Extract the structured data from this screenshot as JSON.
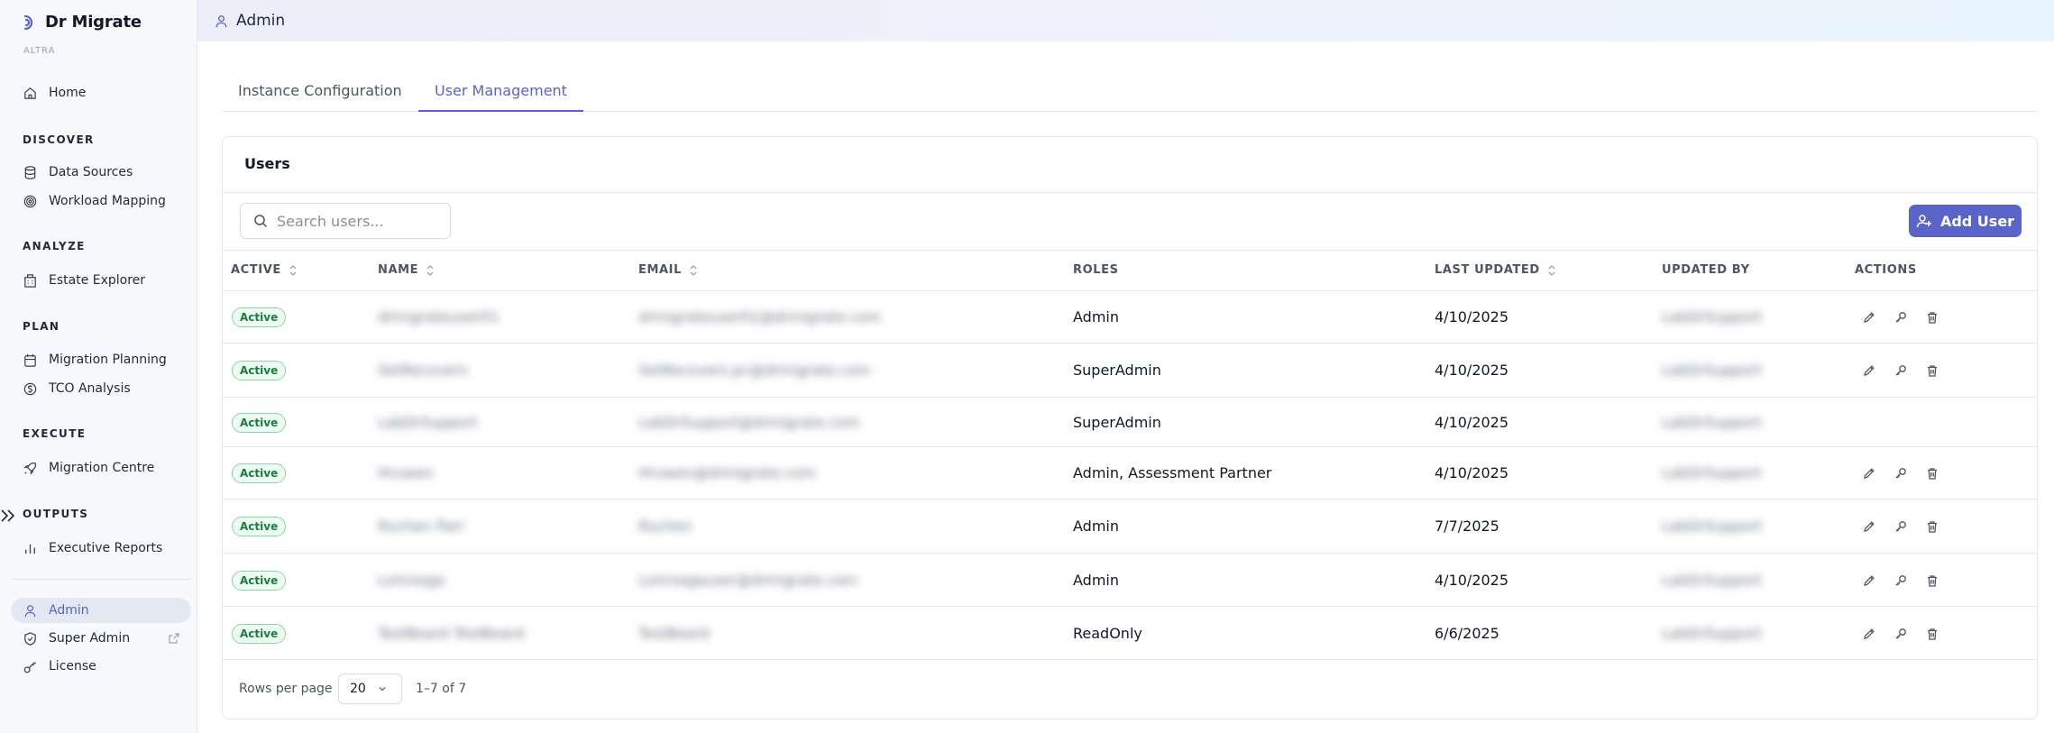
{
  "sidebar": {
    "brand_title": "Dr Migrate",
    "brand_sub": "ALTRA",
    "home": "Home",
    "sections": {
      "discover": "DISCOVER",
      "analyze": "ANALYZE",
      "plan": "PLAN",
      "execute": "EXECUTE",
      "outputs": "OUTPUTS"
    },
    "items": {
      "data_sources": "Data Sources",
      "workload_mapping": "Workload Mapping",
      "estate_explorer": "Estate Explorer",
      "migration_planning": "Migration Planning",
      "tco_analysis": "TCO Analysis",
      "migration_centre": "Migration Centre",
      "executive_reports": "Executive Reports",
      "admin": "Admin",
      "super_admin": "Super Admin",
      "license": "License"
    }
  },
  "header": {
    "title": "Admin"
  },
  "tabs": [
    {
      "label": "Instance Configuration",
      "active": false
    },
    {
      "label": "User Management",
      "active": true
    }
  ],
  "card": {
    "title": "Users",
    "search_placeholder": "Search users...",
    "add_user_label": "Add User"
  },
  "table": {
    "headers": {
      "active": "ACTIVE",
      "name": "NAME",
      "email": "EMAIL",
      "roles": "ROLES",
      "last_updated": "LAST UPDATED",
      "updated_by": "UPDATED BY",
      "actions": "ACTIONS"
    },
    "rows": [
      {
        "status": "Active",
        "name": "drmigrateuser01",
        "email": "drmigrateuser01@drmigrate.com",
        "roles": "Admin",
        "last_updated": "4/10/2025",
        "updated_by": "LabDrSupport",
        "has_actions": true
      },
      {
        "status": "Active",
        "name": "SetRecovers",
        "email": "SetRecovers.pc@drmigrate.com",
        "roles": "SuperAdmin",
        "last_updated": "4/10/2025",
        "updated_by": "LabDrSupport",
        "has_actions": true
      },
      {
        "status": "Active",
        "name": "LabDrSupport",
        "email": "LabDrSupport@drmigrate.com",
        "roles": "SuperAdmin",
        "last_updated": "4/10/2025",
        "updated_by": "LabDrSupport",
        "has_actions": false
      },
      {
        "status": "Active",
        "name": "Hruwen",
        "email": "Hruwen@drmigrate.com",
        "roles": "Admin, Assessment Partner",
        "last_updated": "4/10/2025",
        "updated_by": "LabDrSupport",
        "has_actions": true
      },
      {
        "status": "Active",
        "name": "Ruchen Parr",
        "email": "Ruchen",
        "roles": "Admin",
        "last_updated": "7/7/2025",
        "updated_by": "LabDrSupport",
        "has_actions": true
      },
      {
        "status": "Active",
        "name": "Lomnega",
        "email": "Lomnegauser@drmigrate.com",
        "roles": "Admin",
        "last_updated": "4/10/2025",
        "updated_by": "LabDrSupport",
        "has_actions": true
      },
      {
        "status": "Active",
        "name": "TestBeard TestBeard",
        "email": "TestBeard",
        "roles": "ReadOnly",
        "last_updated": "6/6/2025",
        "updated_by": "LabDrSupport",
        "has_actions": true
      }
    ]
  },
  "pagination": {
    "rows_per_page_label": "Rows per page",
    "rows_per_page_value": "20",
    "range": "1–7 of 7"
  },
  "colors": {
    "accent": "#5a64c8",
    "active_badge_border": "#86d7a4",
    "active_badge_text": "#16803d"
  }
}
